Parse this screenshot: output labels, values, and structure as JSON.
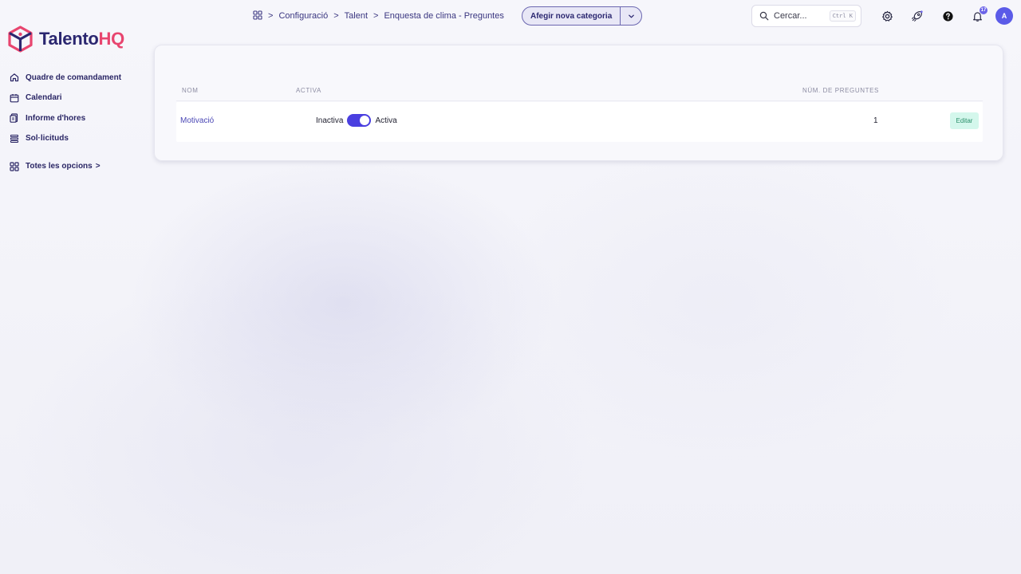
{
  "logo": {
    "part_a": "Talento",
    "part_b": "HQ",
    "icon": "cube-logo-icon",
    "colors": {
      "primary": "#2b2770",
      "accent": "#e8456f"
    }
  },
  "sidebar": {
    "items": [
      {
        "label": "Quadre de comandament",
        "icon": "home-icon"
      },
      {
        "label": "Calendari",
        "icon": "calendar-icon"
      },
      {
        "label": "Informe d'hores",
        "icon": "report-icon"
      },
      {
        "label": "Sol·licituds",
        "icon": "list-icon"
      }
    ],
    "all_options": {
      "label": "Totes les opcions",
      "icon": "grid-icon",
      "chevron": ">"
    }
  },
  "header": {
    "breadcrumb": {
      "icon": "apps-grid-icon",
      "items": [
        "Configuració",
        "Talent",
        "Enquesta de clima - Preguntes"
      ],
      "separator": ">"
    },
    "primary_action": {
      "label": "Afegir nova categoria"
    },
    "search": {
      "placeholder": "Cercar...",
      "shortcut": "Ctrl K"
    },
    "notifications": {
      "count": "17"
    },
    "avatar": {
      "initial": "A"
    }
  },
  "table": {
    "columns": {
      "name": "NOM",
      "active": "ACTIVA",
      "count": "NÚM. DE PREGUNTES"
    },
    "rows": [
      {
        "name": "Motivació",
        "toggle_off_label": "Inactiva",
        "toggle_on_label": "Activa",
        "active": true,
        "count": "1",
        "action": "Editar"
      }
    ]
  },
  "colors": {
    "accent": "#4a3fe0",
    "edit_bg": "#d4f7ec",
    "edit_text": "#2a8f6a"
  }
}
